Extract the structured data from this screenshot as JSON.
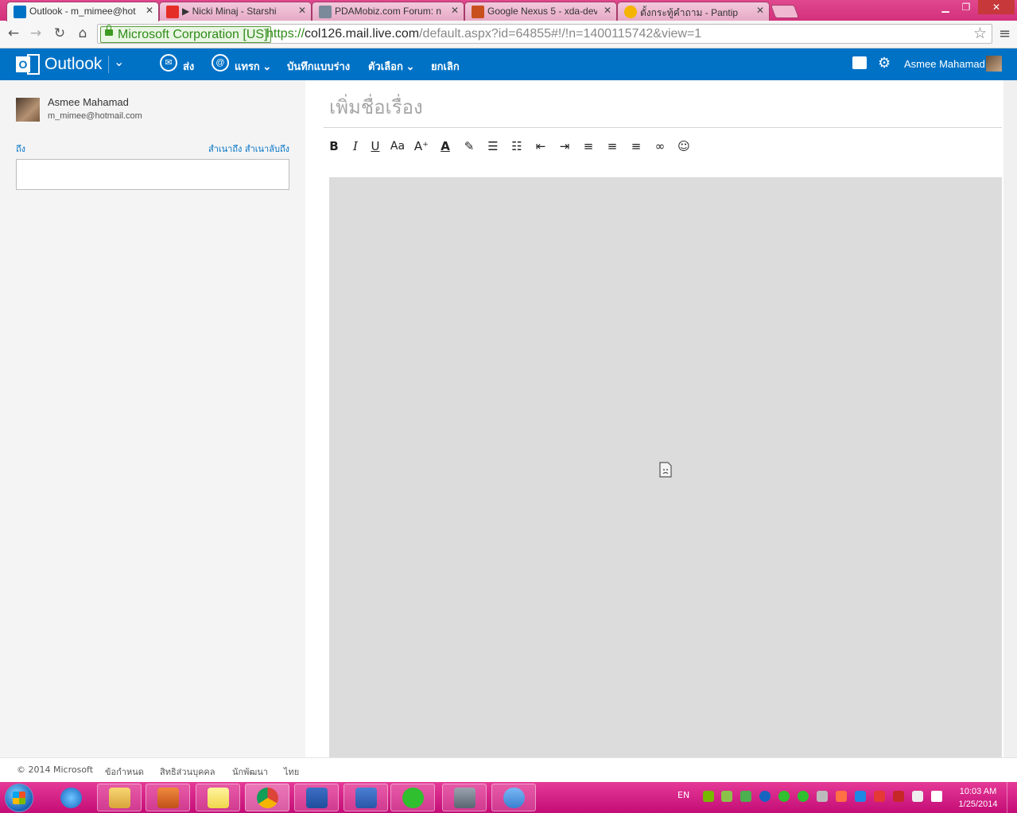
{
  "browser": {
    "tabs": [
      {
        "label": "Outlook - m_mimee@hot",
        "color": "#0072c6",
        "active": true
      },
      {
        "label": "▶ Nicki Minaj - Starshi",
        "color": "#e52d27",
        "active": false
      },
      {
        "label": "PDAMobiz.com Forum: n",
        "color": "#7a8a9a",
        "active": false
      },
      {
        "label": "Google Nexus 5 - xda-dev",
        "color": "#c8501e",
        "active": false
      },
      {
        "label": "ตั้งกระทู้คำถาม - Pantip",
        "color": "#f4b400",
        "active": false
      }
    ],
    "address": {
      "ev_label": "Microsoft Corporation [US]",
      "protocol": "https://",
      "host": "col126.mail.live.com",
      "path": "/default.aspx?id=64855#!/!n=1400115742&view=1"
    }
  },
  "outlook": {
    "brand": "Outlook",
    "commands": {
      "send": "ส่ง",
      "insert": "แทรก",
      "save_draft": "บันทึกแบบร่าง",
      "options": "ตัวเลือก",
      "cancel": "ยกเลิก"
    },
    "user_name": "Asmee Mahamad"
  },
  "compose": {
    "account_name": "Asmee Mahamad",
    "account_email": "m_mimee@hotmail.com",
    "to_label": "ถึง",
    "cc_label": "สำเนาถึง",
    "bcc_label": "สำเนาลับถึง",
    "to_value": "",
    "subject_placeholder": "เพิ่มชื่อเรื่อง"
  },
  "footer": {
    "copyright": "© 2014 Microsoft",
    "terms": "ข้อกำหนด",
    "privacy": "สิทธิส่วนบุคคล",
    "developers": "นักพัฒนา",
    "language": "ไทย"
  },
  "taskbar": {
    "language": "EN",
    "time": "10:03 AM",
    "date": "1/25/2014"
  }
}
